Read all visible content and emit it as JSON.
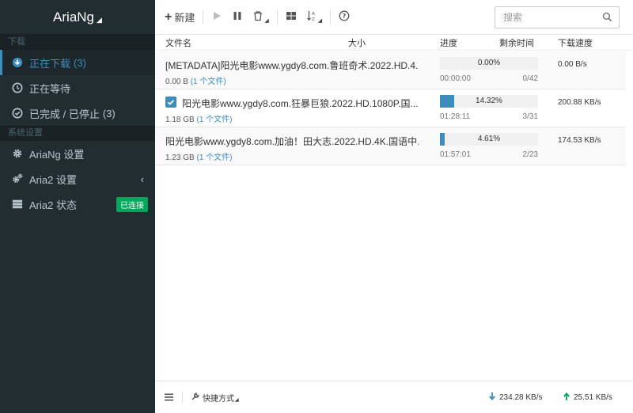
{
  "brand": {
    "title": "AriaNg"
  },
  "sidebar": {
    "section_download": "下载",
    "items": [
      {
        "label": "正在下载",
        "count": "(3)"
      },
      {
        "label": "正在等待"
      },
      {
        "label": "已完成 / 已停止",
        "count": "(3)"
      }
    ],
    "section_settings": "系统设置",
    "settings": [
      {
        "label": "AriaNg 设置"
      },
      {
        "label": "Aria2 设置"
      },
      {
        "label": "Aria2 状态",
        "badge": "已连接"
      }
    ]
  },
  "toolbar": {
    "new_label": "新建",
    "search_placeholder": "搜索"
  },
  "columns": {
    "name": "文件名",
    "size": "大小",
    "progress": "进度",
    "remaining": "剩余时间",
    "speed": "下载速度"
  },
  "tasks": [
    {
      "name": "[METADATA]阳光电影www.ygdy8.com.鲁班奇术.2022.HD.4...",
      "size": "0.00 B",
      "files": "(1 个文件)",
      "progress": 0.0,
      "progress_text": "0.00%",
      "remaining": "00:00:00",
      "pieces": "0/42",
      "speed": "0.00 B/s",
      "checked": false
    },
    {
      "name": "阳光电影www.ygdy8.com.狂暴巨狼.2022.HD.1080P.国...",
      "size": "1.18 GB",
      "files": "(1 个文件)",
      "progress": 14.32,
      "progress_text": "14.32%",
      "remaining": "01:28:11",
      "pieces": "3/31",
      "speed": "200.88 KB/s",
      "checked": true
    },
    {
      "name": "阳光电影www.ygdy8.com.加油！田大志.2022.HD.4K.国语中...",
      "size": "1.23 GB",
      "files": "(1 个文件)",
      "progress": 4.61,
      "progress_text": "4.61%",
      "remaining": "01:57:01",
      "pieces": "2/23",
      "speed": "174.53 KB/s",
      "checked": false
    }
  ],
  "footer": {
    "shortcut_label": "快捷方式",
    "download_speed": "234.28 KB/s",
    "upload_speed": "25.51 KB/s"
  },
  "colors": {
    "sidebar_bg": "#222d32",
    "accent": "#3c8dbc",
    "badge_green": "#00a65a",
    "download_arrow": "#3c8dbc",
    "upload_arrow": "#00a65a"
  }
}
